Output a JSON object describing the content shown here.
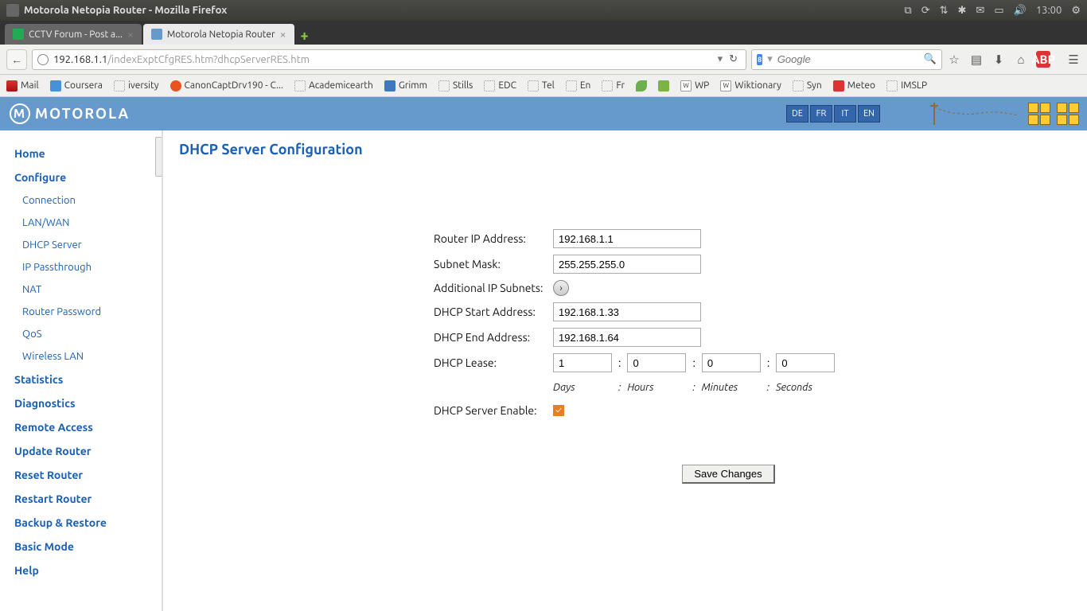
{
  "os": {
    "window_title": "Motorola Netopia Router - Mozilla Firefox",
    "clock": "13:00"
  },
  "tabs": [
    {
      "label": "CCTV Forum - Post a...",
      "active": false
    },
    {
      "label": "Motorola Netopia Router",
      "active": true
    }
  ],
  "url": {
    "host": "192.168.1.1",
    "path": "/indexExptCfgRES.htm?dhcpServerRES.htm"
  },
  "search": {
    "placeholder": "Google"
  },
  "bookmarks": [
    {
      "label": "Mail",
      "ico": "mail"
    },
    {
      "label": "Coursera",
      "ico": "blue"
    },
    {
      "label": "iversity",
      "ico": ""
    },
    {
      "label": "CanonCaptDrv190 - C...",
      "ico": "orange"
    },
    {
      "label": "Academicearth",
      "ico": ""
    },
    {
      "label": "Grimm",
      "ico": "grimm"
    },
    {
      "label": "Stills",
      "ico": ""
    },
    {
      "label": "EDC",
      "ico": ""
    },
    {
      "label": "Tel",
      "ico": ""
    },
    {
      "label": "En",
      "ico": ""
    },
    {
      "label": "Fr",
      "ico": ""
    },
    {
      "label": "",
      "ico": "leaf"
    },
    {
      "label": "",
      "ico": "green"
    },
    {
      "label": "WP",
      "ico": "wp"
    },
    {
      "label": "Wiktionary",
      "ico": "wp"
    },
    {
      "label": "Syn",
      "ico": ""
    },
    {
      "label": "Meteo",
      "ico": "red"
    },
    {
      "label": "IMSLP",
      "ico": ""
    }
  ],
  "router": {
    "brand": "MOTOROLA",
    "langs": [
      "DE",
      "FR",
      "IT",
      "EN"
    ]
  },
  "sidebar": {
    "items": [
      {
        "label": "Home",
        "type": "main"
      },
      {
        "label": "Configure",
        "type": "main"
      },
      {
        "label": "Connection",
        "type": "sub"
      },
      {
        "label": "LAN/WAN",
        "type": "sub"
      },
      {
        "label": "DHCP Server",
        "type": "sub"
      },
      {
        "label": "IP Passthrough",
        "type": "sub"
      },
      {
        "label": "NAT",
        "type": "sub"
      },
      {
        "label": "Router Password",
        "type": "sub"
      },
      {
        "label": "QoS",
        "type": "sub"
      },
      {
        "label": "Wireless LAN",
        "type": "sub"
      },
      {
        "label": "Statistics",
        "type": "main"
      },
      {
        "label": "Diagnostics",
        "type": "main"
      },
      {
        "label": "Remote Access",
        "type": "main"
      },
      {
        "label": "Update Router",
        "type": "main"
      },
      {
        "label": "Reset Router",
        "type": "main"
      },
      {
        "label": "Restart Router",
        "type": "main"
      },
      {
        "label": "Backup & Restore",
        "type": "main"
      },
      {
        "label": "Basic Mode",
        "type": "main"
      },
      {
        "label": "Help",
        "type": "main"
      }
    ]
  },
  "page": {
    "title": "DHCP Server Configuration",
    "labels": {
      "router_ip": "Router IP Address:",
      "subnet": "Subnet Mask:",
      "addl_subnets": "Additional IP Subnets:",
      "dhcp_start": "DHCP Start Address:",
      "dhcp_end": "DHCP End Address:",
      "dhcp_lease": "DHCP Lease:",
      "dhcp_enable": "DHCP Server Enable:"
    },
    "values": {
      "router_ip": "192.168.1.1",
      "subnet": "255.255.255.0",
      "dhcp_start": "192.168.1.33",
      "dhcp_end": "192.168.1.64",
      "lease_days": "1",
      "lease_hours": "0",
      "lease_minutes": "0",
      "lease_seconds": "0",
      "dhcp_enable": true
    },
    "lease_units": {
      "days": "Days",
      "hours": "Hours",
      "minutes": "Minutes",
      "seconds": "Seconds"
    },
    "save_button": "Save Changes"
  }
}
